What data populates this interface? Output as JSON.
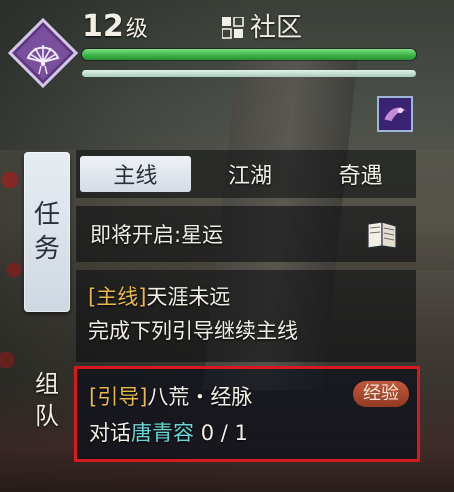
{
  "hud": {
    "level_number": "12",
    "level_unit": "级",
    "community_label": "社区",
    "hp_fraction": 1.0,
    "mp_fraction": 1.0
  },
  "side_tabs": {
    "task_label_1": "任",
    "task_label_2": "务",
    "team_label_1": "组",
    "team_label_2": "队"
  },
  "tabs": [
    "主线",
    "江湖",
    "奇遇"
  ],
  "active_tab": "主线",
  "upcoming": {
    "label": "即将开启:星运"
  },
  "main_quest": {
    "tag": "[主线]",
    "title": "天涯未远",
    "desc": "完成下列引导继续主线"
  },
  "guide_quest": {
    "tag": "[引导]",
    "title": "八荒・经脉",
    "badge": "经验",
    "desc_prefix": "对话",
    "npc": "唐青容",
    "progress": "0 / 1"
  },
  "colors": {
    "highlight_border": "#d41c1c",
    "tag_gold": "#e8b84a",
    "npc_cyan": "#69d6d6",
    "hp_green": "#3eb649",
    "emblem_purple": "#7a4f9e"
  },
  "icons": {
    "emblem": "fan-emblem-icon",
    "community": "grid-icon",
    "buff": "skill-buff-icon",
    "upcoming": "book-icon"
  }
}
